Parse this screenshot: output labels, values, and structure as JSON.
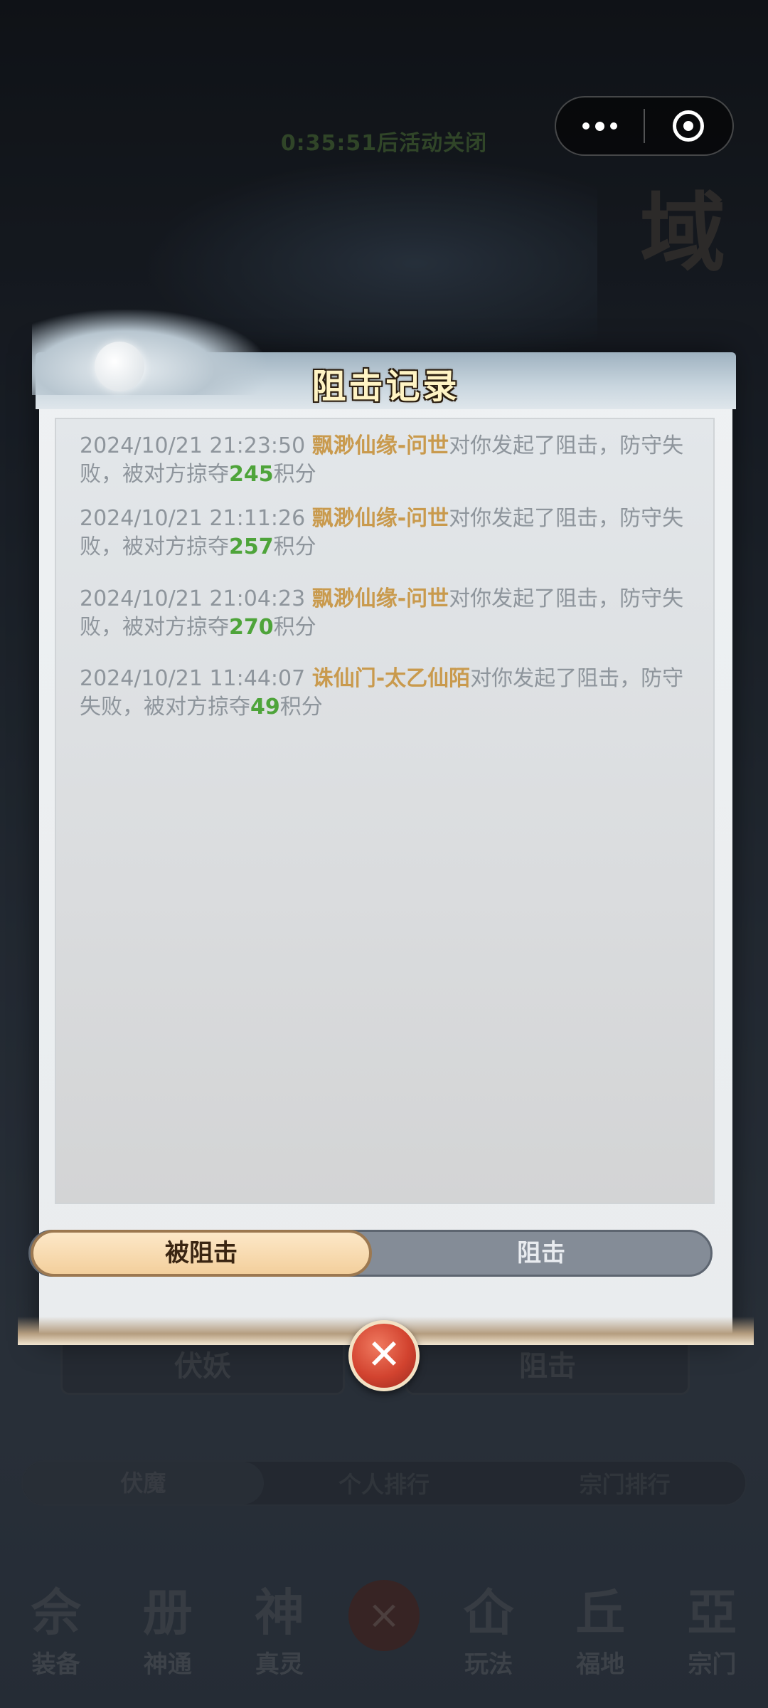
{
  "background": {
    "timer": "0:35:51后活动关闭",
    "big_char": "域",
    "buttons": [
      "伏妖",
      "阻击"
    ],
    "tabs": [
      "伏魔",
      "个人排行",
      "宗门排行"
    ],
    "nav": [
      {
        "glyph": "佘",
        "label": "装备",
        "icon": "equipment-icon"
      },
      {
        "glyph": "册",
        "label": "神通",
        "icon": "skill-book-icon"
      },
      {
        "glyph": "神",
        "label": "真灵",
        "icon": "spirit-icon"
      },
      {
        "glyph": "×",
        "label": "",
        "icon": "close-icon"
      },
      {
        "glyph": "仚",
        "label": "玩法",
        "icon": "gameplay-icon"
      },
      {
        "glyph": "丘",
        "label": "福地",
        "icon": "blessed-land-icon"
      },
      {
        "glyph": "亞",
        "label": "宗门",
        "icon": "sect-icon"
      }
    ]
  },
  "capsule": {
    "more_icon": "more-dots-icon",
    "close_icon": "exit-circle-icon"
  },
  "modal": {
    "title": "阻击记录",
    "records": [
      {
        "time": "2024/10/21 21:23:50",
        "name": "飘渺仙缘-问世",
        "text_a": "对你发起了阻击，防守失败，被对方掠夺",
        "points": "245",
        "text_b": "积分"
      },
      {
        "time": "2024/10/21 21:11:26",
        "name": "飘渺仙缘-问世",
        "text_a": "对你发起了阻击，防守失败，被对方掠夺",
        "points": "257",
        "text_b": "积分"
      },
      {
        "time": "2024/10/21 21:04:23",
        "name": "飘渺仙缘-问世",
        "text_a": "对你发起了阻击，防守失败，被对方掠夺",
        "points": "270",
        "text_b": "积分"
      },
      {
        "time": "2024/10/21 11:44:07",
        "name": "诛仙门-太乙仙陌",
        "text_a": "对你发起了阻击，防守失败，被对方掠夺",
        "points": "49",
        "text_b": "积分"
      }
    ],
    "tabs": {
      "active": "被阻击",
      "inactive": "阻击"
    },
    "close_label": "✕"
  },
  "colors": {
    "name": "#c99a4d",
    "points": "#4ea43a",
    "record_text": "#8e959c"
  }
}
